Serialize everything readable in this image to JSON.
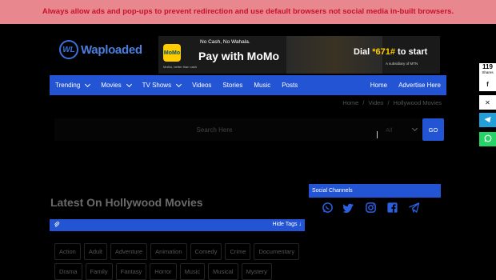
{
  "alert": {
    "text": "Always allow ads and pop-ups to prevent redirection and use default browsers not social media in-built browsers."
  },
  "logo": {
    "mark": "WL",
    "name": "Waploaded"
  },
  "banner": {
    "brand": "MoMo",
    "subline": "MoMo, better than cash",
    "tagline": "No Cash, No Wahala.",
    "headline": "Pay with MoMo",
    "dial_prefix": "Dial ",
    "dial_code": "*671#",
    "dial_suffix": " to start",
    "subsidiary": "A subsidiary of MTN"
  },
  "nav": {
    "left": [
      {
        "label": "Trending",
        "dropdown": true
      },
      {
        "label": "Movies",
        "dropdown": true
      },
      {
        "label": "TV Shows",
        "dropdown": true
      },
      {
        "label": "Videos",
        "dropdown": false
      },
      {
        "label": "Stories",
        "dropdown": false
      },
      {
        "label": "Music",
        "dropdown": false
      },
      {
        "label": "Posts",
        "dropdown": false
      }
    ],
    "right": [
      {
        "label": "Home"
      },
      {
        "label": "Advertise Here"
      }
    ]
  },
  "breadcrumb": {
    "items": [
      "Home",
      "Video",
      "Hollywood Movies"
    ],
    "separator": "/"
  },
  "search": {
    "placeholder": "Search Here",
    "value": "",
    "category": "All",
    "button": "GO"
  },
  "section": {
    "title": "Latest On Hollywood Movies"
  },
  "tagbar": {
    "toggle_label": "Hide Tags ↓"
  },
  "tags": [
    "Action",
    "Adult",
    "Adventure",
    "Animation",
    "Comedy",
    "Crime",
    "Documentary",
    "Drama",
    "Family",
    "Fantasy",
    "Horror",
    "Music",
    "Musical",
    "Mystery"
  ],
  "social": {
    "title": "Social Channels",
    "icons": [
      "whatsapp-icon",
      "twitter-icon",
      "instagram-icon",
      "facebook-icon",
      "telegram-icon"
    ]
  },
  "share": {
    "count": "119",
    "label": "Shares",
    "buttons": [
      {
        "icon": "facebook-icon",
        "color": "#ffffff",
        "fg": "#1a1a1a"
      },
      {
        "icon": "x-icon",
        "color": "#ffffff",
        "fg": "#1a1a1a"
      },
      {
        "icon": "telegram-icon",
        "color": "#229ed9",
        "fg": "#ffffff"
      },
      {
        "icon": "whatsapp-icon",
        "color": "#25d366",
        "fg": "#ffffff"
      }
    ]
  },
  "colors": {
    "accent": "#2354d4",
    "alert_bg": "#e8888e",
    "alert_text": "#c8102e",
    "momo_yellow": "#ffcc00"
  }
}
